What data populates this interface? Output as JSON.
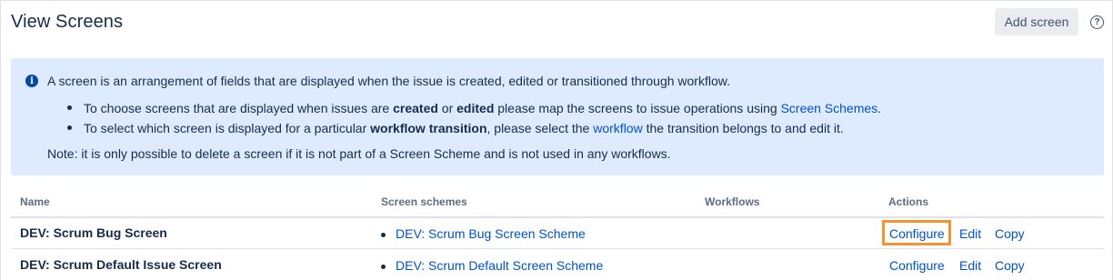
{
  "header": {
    "title": "View Screens",
    "add_button": "Add screen",
    "help_glyph": "?"
  },
  "info": {
    "icon_glyph": "i",
    "main_text": "A screen is an arrangement of fields that are displayed when the issue is created, edited or transitioned through workflow.",
    "bullet1": {
      "pre": "To choose screens that are displayed when issues are ",
      "bold1": "created",
      "mid": " or ",
      "bold2": "edited",
      "post": " please map the screens to issue operations using ",
      "link": "Screen Schemes",
      "end": "."
    },
    "bullet2": {
      "pre": "To select which screen is displayed for a particular ",
      "bold": "workflow transition",
      "mid": ", please select the ",
      "link": "workflow",
      "post": " the transition belongs to and edit it."
    },
    "note": "Note: it is only possible to delete a screen if it is not part of a Screen Scheme and is not used in any workflows."
  },
  "table": {
    "columns": {
      "name": "Name",
      "schemes": "Screen schemes",
      "workflows": "Workflows",
      "actions": "Actions"
    },
    "rows": [
      {
        "name": "DEV: Scrum Bug Screen",
        "scheme": "DEV: Scrum Bug Screen Scheme",
        "configure": "Configure",
        "edit": "Edit",
        "copy": "Copy"
      },
      {
        "name": "DEV: Scrum Default Issue Screen",
        "scheme": "DEV: Scrum Default Screen Scheme",
        "configure": "Configure",
        "edit": "Edit",
        "copy": "Copy"
      }
    ]
  },
  "colors": {
    "link": "#0052cc",
    "info_bg": "#deebff",
    "highlight": "#f79232"
  }
}
